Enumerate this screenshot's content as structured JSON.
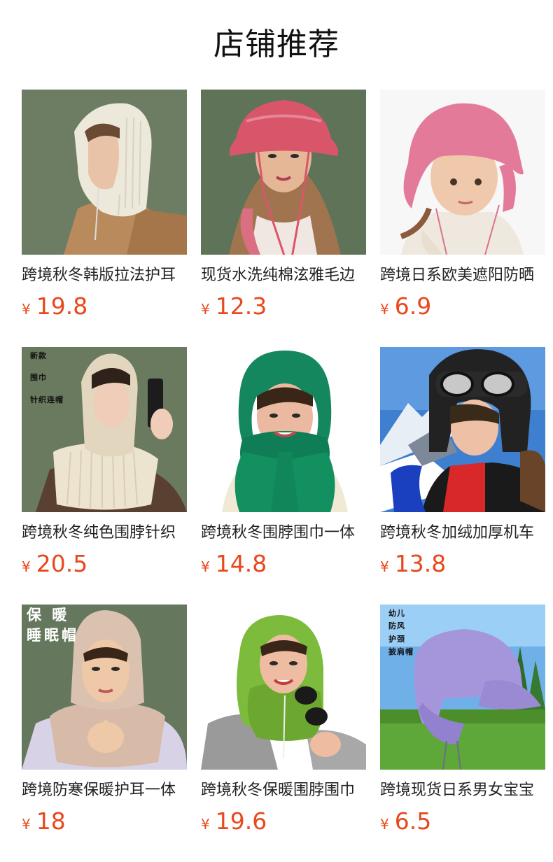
{
  "section": {
    "title": "店铺推荐"
  },
  "currency": "¥",
  "products": [
    {
      "title": "跨境秋冬韩版拉法护耳",
      "price": "19.8",
      "image": "woman-knit-hood-cream"
    },
    {
      "title": "现货水洗纯棉泫雅毛边",
      "price": "12.3",
      "image": "woman-pink-bucket-hat"
    },
    {
      "title": "跨境日系欧美遮阳防晒",
      "price": "6.9",
      "image": "child-pink-sun-hat"
    },
    {
      "title": "跨境秋冬纯色围脖针织",
      "price": "20.5",
      "image": "woman-knit-hood-beige",
      "overlay": [
        "新款",
        "围巾",
        "针织连帽"
      ]
    },
    {
      "title": "跨境秋冬围脖围巾一体",
      "price": "14.8",
      "image": "woman-green-hood-scarf"
    },
    {
      "title": "跨境秋冬加绒加厚机车",
      "price": "13.8",
      "image": "child-aviator-hat-goggles"
    },
    {
      "title": "跨境防寒保暖护耳一体",
      "price": "18",
      "image": "woman-fleece-sleep-hood",
      "overlay": [
        "保 暖",
        "睡眠帽"
      ]
    },
    {
      "title": "跨境秋冬保暖围脖围巾",
      "price": "19.6",
      "image": "woman-lime-knit-hood"
    },
    {
      "title": "跨境现货日系男女宝宝",
      "price": "6.5",
      "image": "purple-flap-cap",
      "overlay": [
        "幼儿",
        "防风",
        "护颈",
        "披肩帽"
      ]
    }
  ],
  "colors": {
    "price": "#e8481c",
    "title_text": "#222222"
  }
}
